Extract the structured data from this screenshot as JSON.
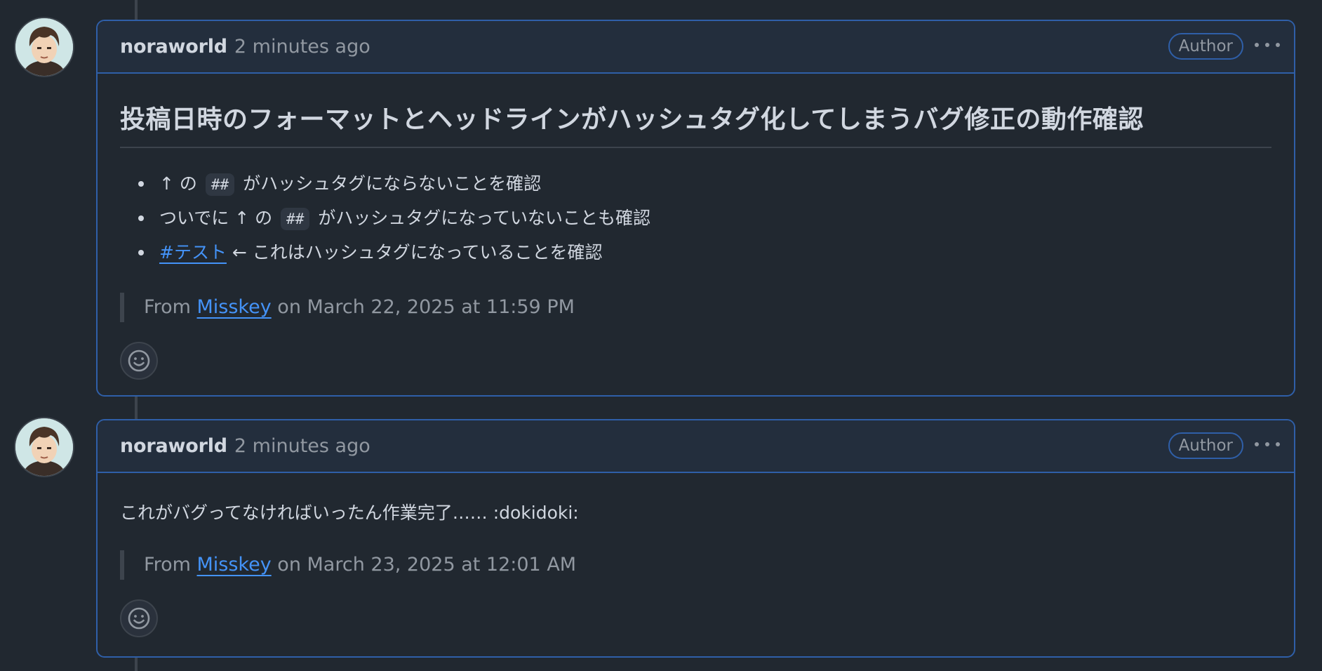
{
  "comments": [
    {
      "author": "noraworld",
      "time": "2 minutes ago",
      "badge": "Author",
      "heading": "投稿日時のフォーマットとヘッドラインがハッシュタグ化してしまうバグ修正の動作確認",
      "bullets": [
        {
          "before": "↑ の",
          "code": "##",
          "after": "がハッシュタグにならないことを確認"
        },
        {
          "before": "ついでに ↑ の",
          "code": "##",
          "after": "がハッシュタグになっていないことも確認"
        },
        {
          "link": "#テスト",
          "after": "← これはハッシュタグになっていることを確認"
        }
      ],
      "quote": {
        "prefix": "From",
        "link": "Misskey",
        "suffix": "on March 22, 2025 at 11:59 PM"
      }
    },
    {
      "author": "noraworld",
      "time": "2 minutes ago",
      "badge": "Author",
      "text": "これがバグってなければいったん作業完了…… :dokidoki:",
      "quote": {
        "prefix": "From",
        "link": "Misskey",
        "suffix": "on March 23, 2025 at 12:01 AM"
      }
    }
  ],
  "icons": {
    "avatar": "avatar-image",
    "more": "kebab-horizontal-icon",
    "reaction": "smiley-icon"
  },
  "colors": {
    "background": "#212830",
    "header_background": "#232e3d",
    "border_accent": "#2f5fa8",
    "link": "#4493f8",
    "muted_text": "#9198a1"
  }
}
